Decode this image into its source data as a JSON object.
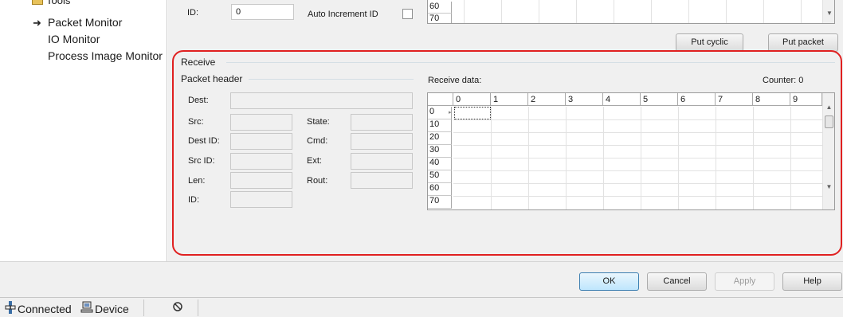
{
  "tree": {
    "folder_label": "Tools",
    "arrow_glyph": "➜",
    "items": [
      "Packet Monitor",
      "IO Monitor",
      "Process Image Monitor"
    ]
  },
  "send": {
    "id_label": "ID:",
    "id_value": "0",
    "auto_increment_label": "Auto Increment ID",
    "row_labels": [
      "60",
      "70"
    ],
    "put_cyclic_label": "Put cyclic",
    "put_packet_label": "Put packet"
  },
  "receive": {
    "group_title": "Receive",
    "header_group_title": "Packet header",
    "fields": {
      "dest": "Dest:",
      "src": "Src:",
      "state": "State:",
      "dest_id": "Dest ID:",
      "cmd": "Cmd:",
      "src_id": "Src ID:",
      "ext": "Ext:",
      "len": "Len:",
      "rout": "Rout:",
      "id": "ID:"
    },
    "data_label": "Receive data:",
    "counter_label": "Counter: 0",
    "columns": [
      "0",
      "1",
      "2",
      "3",
      "4",
      "5",
      "6",
      "7",
      "8",
      "9"
    ],
    "rows": [
      "0",
      "10",
      "20",
      "30",
      "40",
      "50",
      "60",
      "70"
    ]
  },
  "buttons": {
    "ok": "OK",
    "cancel": "Cancel",
    "apply": "Apply",
    "help": "Help"
  },
  "status": {
    "connected": "Connected",
    "device": "Device"
  },
  "colors": {
    "highlight": "#e02020",
    "panel_bg": "#f0f0f0",
    "primary_button_border": "#3c7fb1"
  }
}
